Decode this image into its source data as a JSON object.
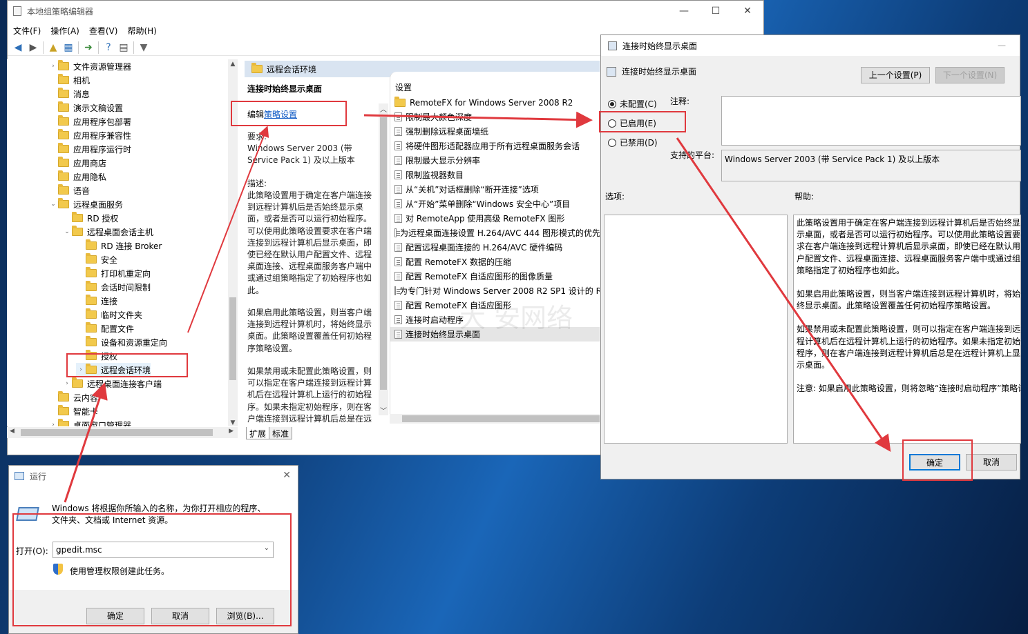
{
  "gpedit": {
    "title": "本地组策略编辑器",
    "menus": [
      "文件(F)",
      "操作(A)",
      "查看(V)",
      "帮助(H)"
    ],
    "tree": [
      {
        "label": "文件资源管理器",
        "indent": 1,
        "arrow": "›"
      },
      {
        "label": "相机",
        "indent": 1,
        "arrow": ""
      },
      {
        "label": "消息",
        "indent": 1,
        "arrow": ""
      },
      {
        "label": "演示文稿设置",
        "indent": 1,
        "arrow": ""
      },
      {
        "label": "应用程序包部署",
        "indent": 1,
        "arrow": ""
      },
      {
        "label": "应用程序兼容性",
        "indent": 1,
        "arrow": ""
      },
      {
        "label": "应用程序运行时",
        "indent": 1,
        "arrow": ""
      },
      {
        "label": "应用商店",
        "indent": 1,
        "arrow": ""
      },
      {
        "label": "应用隐私",
        "indent": 1,
        "arrow": ""
      },
      {
        "label": "语音",
        "indent": 1,
        "arrow": ""
      },
      {
        "label": "远程桌面服务",
        "indent": 1,
        "arrow": "⌄"
      },
      {
        "label": "RD 授权",
        "indent": 2,
        "arrow": ""
      },
      {
        "label": "远程桌面会话主机",
        "indent": 2,
        "arrow": "⌄"
      },
      {
        "label": "RD 连接 Broker",
        "indent": 3,
        "arrow": ""
      },
      {
        "label": "安全",
        "indent": 3,
        "arrow": ""
      },
      {
        "label": "打印机重定向",
        "indent": 3,
        "arrow": ""
      },
      {
        "label": "会话时间限制",
        "indent": 3,
        "arrow": ""
      },
      {
        "label": "连接",
        "indent": 3,
        "arrow": ""
      },
      {
        "label": "临时文件夹",
        "indent": 3,
        "arrow": ""
      },
      {
        "label": "配置文件",
        "indent": 3,
        "arrow": ""
      },
      {
        "label": "设备和资源重定向",
        "indent": 3,
        "arrow": ""
      },
      {
        "label": "授权",
        "indent": 3,
        "arrow": ""
      },
      {
        "label": "远程会话环境",
        "indent": 3,
        "arrow": "›",
        "selected": true
      },
      {
        "label": "远程桌面连接客户端",
        "indent": 2,
        "arrow": "›"
      },
      {
        "label": "云内容",
        "indent": 1,
        "arrow": ""
      },
      {
        "label": "智能卡",
        "indent": 1,
        "arrow": ""
      },
      {
        "label": "桌面窗口管理器",
        "indent": 1,
        "arrow": "›"
      }
    ],
    "pane_title": "远程会话环境",
    "policy_name": "连接时始终显示桌面",
    "edit_prefix": "编辑",
    "edit_link": "策略设置",
    "requirements_label": "要求:",
    "requirements": "Windows Server 2003 (带 Service Pack 1) 及以上版本",
    "description_label": "描述:",
    "description": [
      "此策略设置用于确定在客户端连接到远程计算机后是否始终显示桌面，或者是否可以运行初始程序。可以使用此策略设置要求在客户端连接到远程计算机后显示桌面，即使已经在默认用户配置文件、远程桌面连接、远程桌面服务客户端中或通过组策略指定了初始程序也如此。",
      "如果启用此策略设置，则当客户端连接到远程计算机时，将始终显示桌面。此策略设置覆盖任何初始程序策略设置。",
      "如果禁用或未配置此策略设置，则可以指定在客户端连接到远程计算机后在远程计算机上运行的初始程序。如果未指定初始程序，则在客户端连接到远程计算机后总是在远"
    ],
    "settings_header": "设置",
    "settings": [
      {
        "label": "RemoteFX for Windows Server 2008 R2",
        "folder": true
      },
      {
        "label": "限制最大颜色深度"
      },
      {
        "label": "强制删除远程桌面墙纸"
      },
      {
        "label": "将硬件图形适配器应用于所有远程桌面服务会话"
      },
      {
        "label": "限制最大显示分辨率"
      },
      {
        "label": "限制监视器数目"
      },
      {
        "label": "从“关机”对话框删除“断开连接”选项"
      },
      {
        "label": "从“开始”菜单删除“Windows 安全中心”项目"
      },
      {
        "label": "对 RemoteApp 使用高级 RemoteFX 图形"
      },
      {
        "label": "为远程桌面连接设置 H.264/AVC 444 图形模式的优先"
      },
      {
        "label": "配置远程桌面连接的 H.264/AVC 硬件编码"
      },
      {
        "label": "配置 RemoteFX 数据的压缩"
      },
      {
        "label": "配置 RemoteFX 自适应图形的图像质量"
      },
      {
        "label": "为专门针对 Windows Server 2008 R2 SP1 设计的 R"
      },
      {
        "label": "配置 RemoteFX 自适应图形"
      },
      {
        "label": "连接时启动程序"
      },
      {
        "label": "连接时始终显示桌面",
        "selected": true
      }
    ],
    "tabs": [
      "扩展",
      "标准"
    ],
    "watermark": "大 安网络"
  },
  "policy": {
    "title": "连接时始终显示桌面",
    "header": "连接时始终显示桌面",
    "prev": "上一个设置(P)",
    "next": "下一个设置(N)",
    "radio_not_configured": "未配置(C)",
    "radio_enabled": "已启用(E)",
    "radio_disabled": "已禁用(D)",
    "comment_label": "注释:",
    "platform_label": "支持的平台:",
    "platform": "Windows Server 2003 (带 Service Pack 1) 及以上版本",
    "options_label": "选项:",
    "help_label": "帮助:",
    "help": [
      "此策略设置用于确定在客户端连接到远程计算机后是否始终显示桌面，或者是否可以运行初始程序。可以使用此策略设置要求在客户端连接到远程计算机后显示桌面，即使已经在默认用户配置文件、远程桌面连接、远程桌面服务客户端中或通过组策略指定了初始程序也如此。",
      "如果启用此策略设置，则当客户端连接到远程计算机时，将始终显示桌面。此策略设置覆盖任何初始程序策略设置。",
      "如果禁用或未配置此策略设置，则可以指定在客户端连接到远程计算机后在远程计算机上运行的初始程序。如果未指定初始程序，则在客户端连接到远程计算机后总是在远程计算机上显示桌面。",
      "注意: 如果启用此策略设置，则将忽略“连接时启动程序”策略设置。"
    ],
    "ok": "确定",
    "cancel": "取消"
  },
  "run": {
    "title": "运行",
    "message": "Windows 将根据你所输入的名称，为你打开相应的程序、文件夹、文档或 Internet 资源。",
    "open_label": "打开(O):",
    "input": "gpedit.msc",
    "admin_note": "使用管理权限创建此任务。",
    "ok": "确定",
    "cancel": "取消",
    "browse": "浏览(B)..."
  },
  "colors": {
    "annotation": "#e0393e",
    "link": "#0b57c4",
    "accent": "#0078d7"
  }
}
